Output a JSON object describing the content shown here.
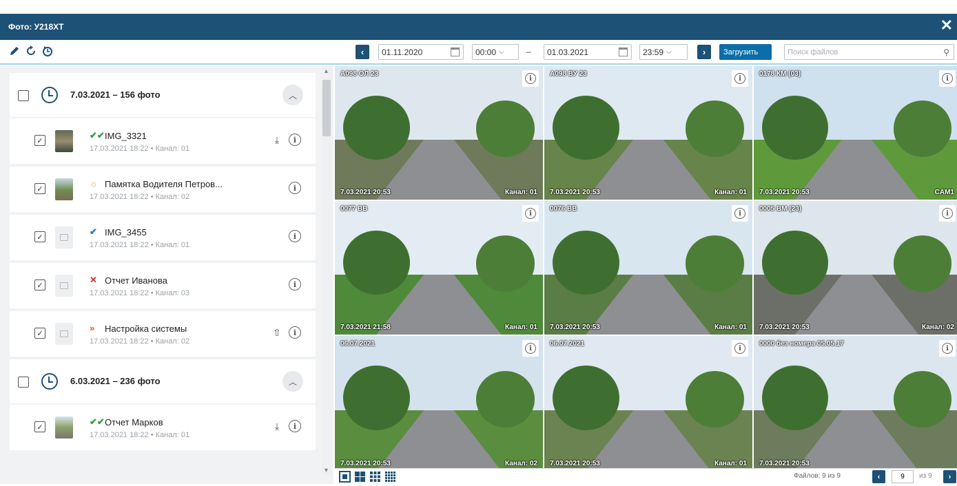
{
  "window": {
    "title": "Фото: У218ХТ"
  },
  "toolbar": {
    "date_from": "01.11.2020",
    "time_from": "00:00",
    "dash": "–",
    "date_to": "01.03.2021",
    "time_to": "23:59",
    "upload_label": "Загрузить",
    "search_placeholder": "Поиск файлов"
  },
  "groups": [
    {
      "title": "7.03.2021 – 156 фото",
      "items": [
        {
          "name": "IMG_3321",
          "meta": "17.03.2021 18:22 • Канал: 01",
          "status": "double-check",
          "status_color": "#2e9e3f",
          "thumb": "img1",
          "actions": [
            "download",
            "info"
          ]
        },
        {
          "name": "Памятка Водителя Петров...",
          "meta": "17.03.2021 18:22 • Канал: 02",
          "status": "processing",
          "status_color": "#f0a020",
          "thumb": "img2",
          "actions": [
            "info"
          ]
        },
        {
          "name": "IMG_3455",
          "meta": "17.03.2021 18:22 • Канал: 01",
          "status": "check",
          "status_color": "#1f7bbf",
          "thumb": "placeholder",
          "actions": [
            "info"
          ]
        },
        {
          "name": "Отчет Иванова",
          "meta": "17.03.2021 18:22 • Канал: 03",
          "status": "error",
          "status_color": "#d32f2f",
          "thumb": "placeholder",
          "actions": [
            "info"
          ]
        },
        {
          "name": "Настройка системы",
          "meta": "17.03.2021 18:22 • Канал: 02",
          "status": "forward",
          "status_color": "#e65a1e",
          "thumb": "placeholder",
          "actions": [
            "upload",
            "info"
          ]
        }
      ]
    },
    {
      "title": "6.03.2021 – 236 фото",
      "items": [
        {
          "name": "Отчет Марков",
          "meta": "17.03.2021 18:22 • Канал: 01",
          "status": "double-check",
          "status_color": "#2e9e3f",
          "thumb": "img3",
          "actions": [
            "download",
            "info"
          ]
        }
      ]
    }
  ],
  "photos": [
    {
      "cap_tl": "А098 ОЛ 23",
      "cap_bl": "7.03.2021 20:53",
      "cap_br": "Канал: 01",
      "sky": "#dfe7ee",
      "ground": "#6e7a5a"
    },
    {
      "cap_tl": "А098 ВУ 23",
      "cap_bl": "7.03.2021 20:53",
      "cap_br": "Канал: 01",
      "sky": "#dfe9f2",
      "ground": "#67844a"
    },
    {
      "cap_tl": "0178 КМ (03)",
      "cap_bl": "7.03.2021 20:53",
      "cap_br": "CAM1",
      "sky": "#cfe0ee",
      "ground": "#5e9a3c"
    },
    {
      "cap_tl": "0077 ВВ",
      "cap_bl": "7.03.2021 21:58",
      "cap_br": "Канал: 01",
      "sky": "#e3ecf3",
      "ground": "#4f8a3a"
    },
    {
      "cap_tl": "0076 ВВ",
      "cap_bl": "7.03.2021 20:53",
      "cap_br": "Канал: 01",
      "sky": "#d8e6f0",
      "ground": "#5a7d45"
    },
    {
      "cap_tl": "0005 ВМ (23)",
      "cap_bl": "7.03.2021 20:53",
      "cap_br": "Канал: 02",
      "sky": "#dde6ec",
      "ground": "#6c6f68"
    },
    {
      "cap_tl": "06.07.2021",
      "cap_bl": "7.03.2021 20:53",
      "cap_br": "Канал: 02",
      "sky": "#d4e2ee",
      "ground": "#5b8d3e"
    },
    {
      "cap_tl": "06.07.2021",
      "cap_bl": "7.03.2021 20:53",
      "cap_br": "Канал: 01",
      "sky": "#e0e9f1",
      "ground": "#6b8350"
    },
    {
      "cap_tl": "0000 без номера 05.05.17",
      "cap_bl": "7.03.2021 20:53",
      "cap_br": "",
      "sky": "#dce6ee",
      "ground": "#6d7c5c"
    }
  ],
  "footer": {
    "files_count": "Файлов: 9 из 9",
    "page": "9",
    "of_pages": "из 9"
  },
  "colors": {
    "titlebar": "#1d5175",
    "accent": "#0c6ea8",
    "panel_bg": "#f1f2f4"
  }
}
